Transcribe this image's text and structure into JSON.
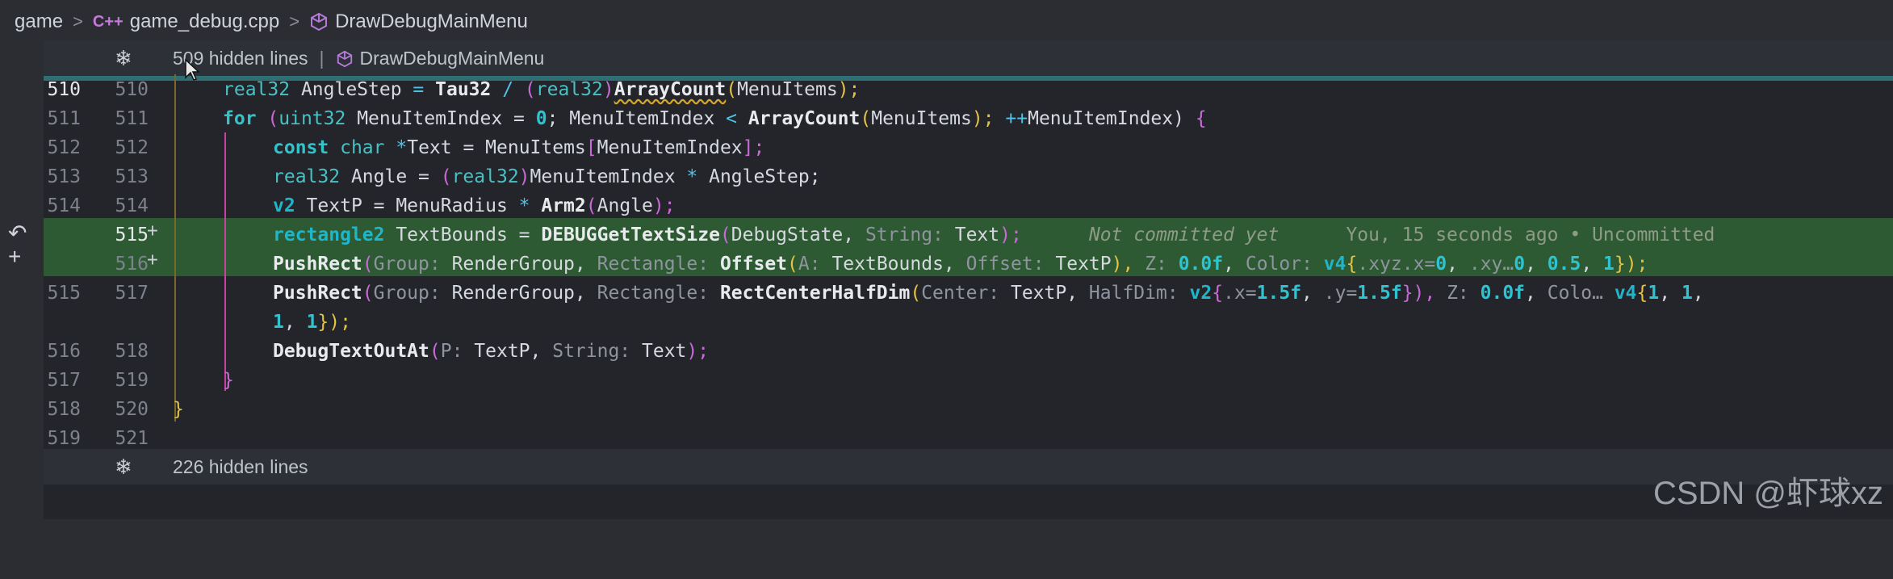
{
  "breadcrumb": {
    "folder": "game",
    "lang_badge": "C++",
    "file": "game_debug.cpp",
    "symbol": "DrawDebugMainMenu",
    "separator": ">"
  },
  "fold_top": {
    "count_label": "509 hidden lines",
    "separator": "|",
    "symbol": "DrawDebugMainMenu"
  },
  "fold_bottom": {
    "count_label": "226 hidden lines"
  },
  "left_line_numbers": [
    "510",
    "511",
    "512",
    "513",
    "514",
    "",
    "",
    "515",
    "",
    "516",
    "517",
    "518",
    "519"
  ],
  "right_line_numbers": [
    "510",
    "511",
    "512",
    "513",
    "514",
    "515",
    "516",
    "517",
    "",
    "518",
    "519",
    "520",
    "521"
  ],
  "added_marker": "+",
  "code": {
    "l510": {
      "a": "real32",
      "b": " AngleStep ",
      "c": "=",
      "d": " Tau32 ",
      "e": "/",
      "f": " (",
      "g": "real32",
      ")": ")",
      "h": "ArrayCount",
      "i": "(",
      "j": "MenuItems",
      "k": ");"
    },
    "l511": {
      "a": "for",
      "b": " (",
      "c": "uint32",
      "d": " MenuItemIndex = ",
      "e": "0",
      "f": "; MenuItemIndex ",
      "g": "<",
      "h": " ArrayCount",
      "i": "(",
      "j": "MenuItems",
      "k": "); ",
      "l": "++",
      "m": "MenuItemIndex) ",
      "n": "{"
    },
    "l512": {
      "a": "const",
      "b": " ",
      "c": "char",
      "d": " ",
      "e": "*",
      "f": "Text = MenuItems",
      "g": "[",
      "h": "MenuItemIndex",
      "i": "];"
    },
    "l513": {
      "a": "real32",
      "b": " Angle = ",
      "c": "(",
      "d": "real32",
      "e": ")",
      "f": "MenuItemIndex ",
      "g": "*",
      "h": " AngleStep;"
    },
    "l514": {
      "a": "v2",
      "b": " TextP = MenuRadius ",
      "c": "*",
      "d": " Arm2",
      "e": "(",
      "f": "Angle",
      "g": ");"
    },
    "l515": {
      "a": "rectangle2",
      "b": " TextBounds = ",
      "c": "DEBUGGetTextSize",
      "d": "(",
      "e": "DebugState, ",
      "f": "String:",
      "g": " Text",
      "h": ");",
      "blame": "Not committed yet",
      "blame2": "You, 15 seconds ago • Uncommitted"
    },
    "l516": {
      "a": "PushRect",
      "b": "(",
      "c": "Group:",
      "d": " RenderGroup, ",
      "e": "Rectangle:",
      "f": " Offset",
      "g": "(",
      "h": "A:",
      "i": " TextBounds, ",
      "j": "Offset:",
      "k": " TextP",
      "l": "), ",
      "m": "Z:",
      "n": " 0.0f",
      "o": ", ",
      "p": "Color:",
      "q": " v4",
      "r": "{",
      "s": ".xyz.x=",
      "t": "0",
      "u": ", ",
      "v": ".xy…",
      "w": "0",
      "x": ", ",
      "y": "0.5",
      "z": ", ",
      "aa": "1",
      "ab": "});"
    },
    "l517": {
      "a": "PushRect",
      "b": "(",
      "c": "Group:",
      "d": " RenderGroup, ",
      "e": "Rectangle:",
      "f": " RectCenterHalfDim",
      "g": "(",
      "h": "Center:",
      "i": " TextP, ",
      "j": "HalfDim:",
      "k": " v2",
      "l": "{",
      "m": ".x=",
      "n": "1.5f",
      "o": ", ",
      "p": ".y=",
      "q": "1.5f",
      "r": "}), ",
      "s": "Z:",
      "t": " 0.0f",
      "u": ", ",
      "v": "Colo…",
      "w": " v4",
      "x": "{",
      "y": "1",
      "z": ", ",
      "aa": "1",
      "ab": ","
    },
    "l517b": {
      "a": "1",
      "b": ", ",
      "c": "1",
      "d": "});"
    },
    "l518": {
      "a": "DebugTextOutAt",
      "b": "(",
      "c": "P:",
      "d": " TextP, ",
      "e": "String:",
      "f": " Text",
      "g": ");"
    },
    "l519": {
      "a": "}"
    },
    "l520": {
      "a": "}"
    }
  },
  "side_icons": {
    "undo": "↶",
    "add": "+"
  },
  "watermark": "CSDN @虾球xz",
  "colors": {
    "added_band": "#2d5a33",
    "fold_accent": "#2f6f73",
    "keyword": "#33c3c8"
  }
}
